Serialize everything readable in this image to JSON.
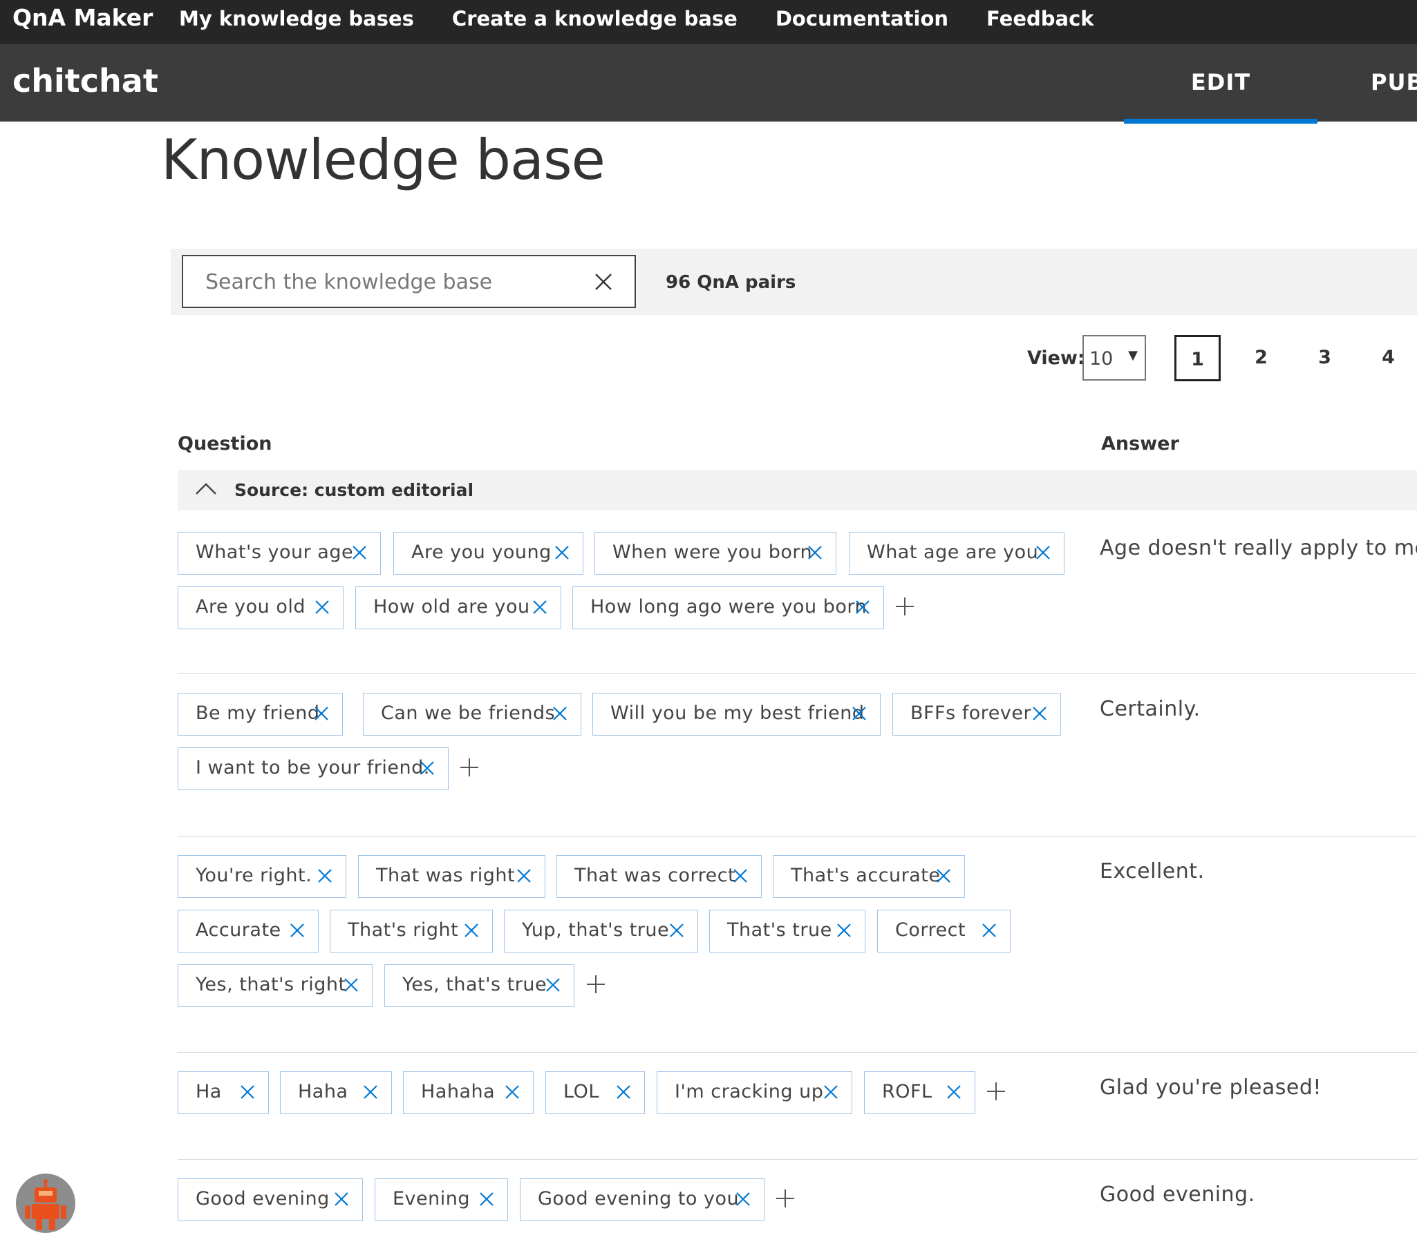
{
  "nav": {
    "brand": "QnA Maker",
    "links": [
      "My knowledge bases",
      "Create a knowledge base",
      "Documentation",
      "Feedback"
    ]
  },
  "kb": {
    "name": "chitchat",
    "tabs": [
      "EDIT",
      "PUB"
    ]
  },
  "page": {
    "title": "Knowledge base"
  },
  "search": {
    "placeholder": "Search the knowledge base",
    "count": "96 QnA pairs"
  },
  "pager": {
    "view_label": "View:",
    "view_value": "10",
    "pages": [
      "1",
      "2",
      "3",
      "4"
    ],
    "active_page": "1"
  },
  "table": {
    "question_header": "Question",
    "answer_header": "Answer",
    "source_label": "Source: custom editorial",
    "rows": [
      {
        "answer": "Age doesn't really apply to me.",
        "questions": [
          "What's your age",
          "Are you young",
          "When were you born",
          "What age are you",
          "Are you old",
          "How old are you",
          "How long ago were you born"
        ]
      },
      {
        "answer": "Certainly.",
        "questions": [
          "Be my friend",
          "Can we be friends",
          "Will you be my best friend",
          "BFFs forever",
          "I want to be your friend."
        ]
      },
      {
        "answer": "Excellent.",
        "questions": [
          "You're right.",
          "That was right",
          "That was correct",
          "That's accurate",
          "Accurate",
          "That's right",
          "Yup, that's true",
          "That's true",
          "Correct",
          "Yes, that's right",
          "Yes, that's true"
        ]
      },
      {
        "answer": "Glad you're pleased!",
        "questions": [
          "Ha",
          "Haha",
          "Hahaha",
          "LOL",
          "I'm cracking up",
          "ROFL"
        ]
      },
      {
        "answer": "Good evening.",
        "questions": [
          "Good evening",
          "Evening",
          "Good evening to you"
        ]
      }
    ]
  },
  "colors": {
    "nav_bg": "#262626",
    "kb_bar_bg": "#3c3c3c",
    "accent": "#0078d4",
    "chip_border": "#9ec4ea",
    "chip_x": "#0078d4",
    "robot": "#e8501e"
  },
  "icons": {
    "clear": "close-icon",
    "chip_remove": "close-icon",
    "add": "plus-icon",
    "collapse": "chevron-up-icon",
    "avatar": "robot-icon"
  }
}
